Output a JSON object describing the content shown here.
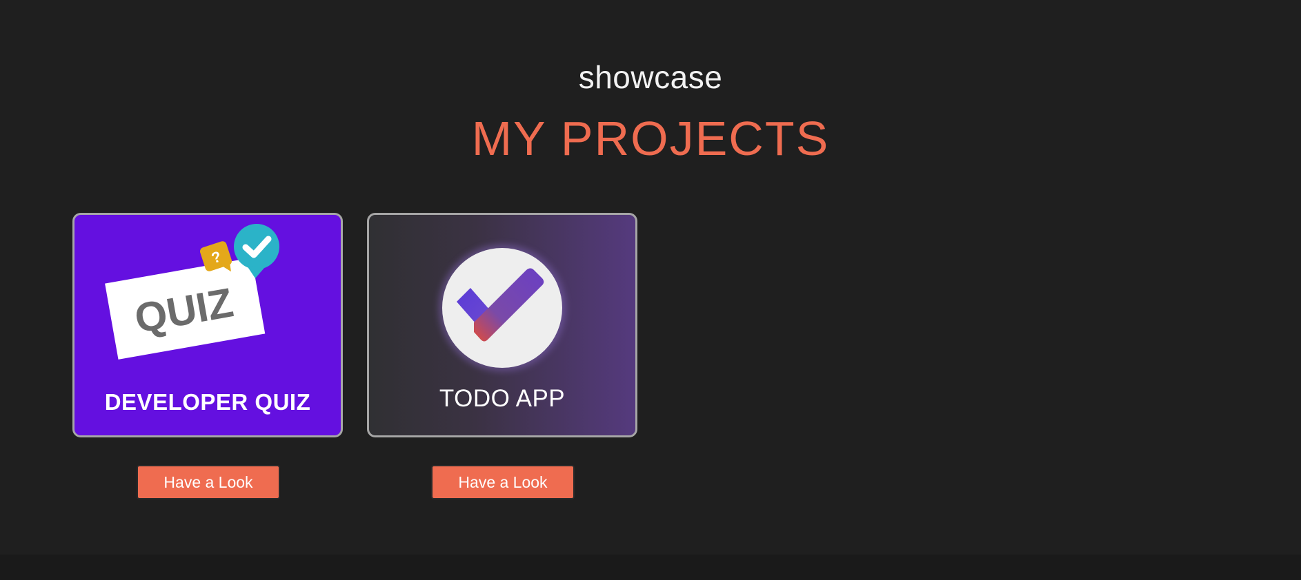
{
  "header": {
    "eyebrow": "showcase",
    "title": "MY PROJECTS"
  },
  "projects": [
    {
      "title": "DEVELOPER QUIZ",
      "logo_text": "QUIZ",
      "logo_bubble_mark": "?",
      "logo_icon": "quiz-logo-icon",
      "button_label": "Have a Look",
      "background": "#6410e0"
    },
    {
      "title": "TODO APP",
      "logo_icon": "checkmark-icon",
      "button_label": "Have a Look",
      "background": "#553a7e"
    }
  ],
  "colors": {
    "page_background": "#1f1f1f",
    "accent": "#ef6c50",
    "card_border": "#a6a6a6"
  }
}
